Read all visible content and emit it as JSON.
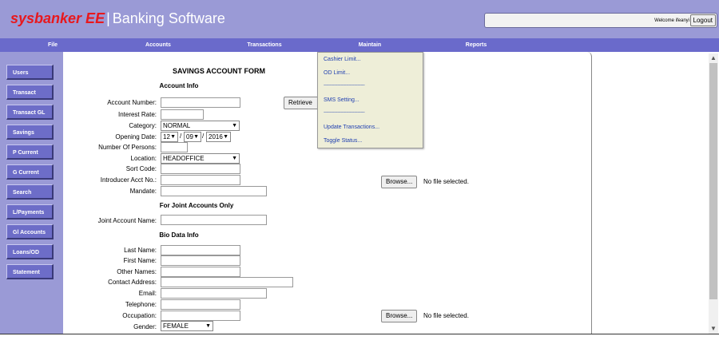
{
  "header": {
    "brand_name": "sysbanker EE",
    "separator": "|",
    "tagline": "Banking Software",
    "welcome": "Welcome ifeanyi",
    "logout": "Logout"
  },
  "menubar": {
    "file": "File",
    "accounts": "Accounts",
    "transactions": "Transactions",
    "maintain": "Maintain",
    "reports": "Reports"
  },
  "sidebar": {
    "users": "Users",
    "transact": "Transact",
    "transact_gl": "Transact GL",
    "savings": "Savings",
    "p_current": "P Current",
    "g_current": "G Current",
    "search": "Search",
    "l_payments": "L/Payments",
    "gl_accounts": "Gl Accounts",
    "loans_od": "Loans/OD",
    "statement": "Statement"
  },
  "maintain_menu": {
    "cashier_limit": "Cashier Limit...",
    "od_limit": "OD Limit...",
    "separator1": "--------------------------------------------",
    "sms_setting": "SMS Setting...",
    "separator2": "--------------------------------------------",
    "update_transactions": "Update Transactions...",
    "toggle_status": "Toggle Status..."
  },
  "form": {
    "title": "SAVINGS ACCOUNT FORM",
    "account_info": "Account Info",
    "account_number_label": "Account Number:",
    "retrieve_label": "Retrieve A",
    "interest_rate_label": "Interest Rate:",
    "category_label": "Category:",
    "category_value": "NORMAL",
    "opening_date_label": "Opening Date:",
    "opening_day": "12",
    "opening_month": "09",
    "opening_year": "2016",
    "date_sep": "/",
    "persons_label": "Number Of Persons:",
    "location_label": "Location:",
    "location_value": "HEADOFFICE",
    "sort_code_label": "Sort Code:",
    "introducer_label": "Introducer Acct No.:",
    "mandate_label": "Mandate:",
    "browse_label": "Browse...",
    "no_file": "No file selected.",
    "joint_title": "For Joint Accounts Only",
    "joint_name_label": "Joint Account Name:",
    "bio_title": "Bio Data Info",
    "last_name_label": "Last Name:",
    "first_name_label": "First Name:",
    "other_names_label": "Other Names:",
    "contact_address_label": "Contact Address:",
    "email_label": "Email:",
    "telephone_label": "Telephone:",
    "occupation_label": "Occupation:",
    "gender_label": "Gender:",
    "gender_value": "FEMALE"
  },
  "colors": {
    "header_bg": "#9a9ad6",
    "menubar_bg": "#6a6acb",
    "sidebar_button": "#6d6dc8",
    "brand_red": "#e8181d",
    "dropdown_bg": "#eeeed8",
    "dropdown_link": "#1f3fb0"
  },
  "icons": {
    "caret": "chevron-down-icon",
    "scroll_up": "arrow-up-icon",
    "scroll_down": "arrow-down-icon"
  }
}
